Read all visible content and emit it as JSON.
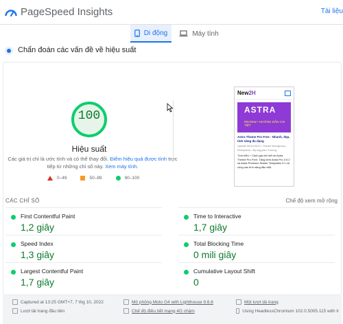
{
  "header": {
    "title": "PageSpeed Insights",
    "right_link": "Tài liệu"
  },
  "tabs": [
    {
      "label": "Di động",
      "active": true,
      "icon": "smartphone-icon"
    },
    {
      "label": "Máy tính",
      "active": false,
      "icon": "laptop-icon"
    }
  ],
  "diagnose": {
    "text": "Chẩn đoán các vấn đề về hiệu suất"
  },
  "performance": {
    "score": "100",
    "label": "Hiệu suất",
    "note_pre": "Các giá trị chỉ là ước tính và có thể thay đổi.",
    "note_link1": "Điểm hiệu quả được tính",
    "note_mid": "trực tiếp từ những chỉ số này.",
    "note_link2": "Xem máy tính",
    "note_end": ".",
    "legend": [
      {
        "range": "0–49",
        "shape": "triangle",
        "color": "#d93025"
      },
      {
        "range": "50–89",
        "shape": "square",
        "color": "#fa9a25"
      },
      {
        "range": "90–100",
        "shape": "circle",
        "color": "#0cce6b"
      }
    ],
    "colors": {
      "good": "#0cce6b",
      "good_text": "#0c7a2c"
    }
  },
  "preview": {
    "logo_main": "New",
    "logo_accent": "2H",
    "banner_title": "ASTRA",
    "banner_sub": "REVIEW • HƯỚNG DẪN CHI TIẾT",
    "article_title": "Astra Theme Pro Free - Nhanh, đẹp, tính năng đa dạng",
    "article_meta": "Update 06/11/2022 / Theme Wordpress, Wordpress / By tag plan 4 luong",
    "article_body": "Tình hiểu + Cách gia chỉ hiết về Astra Theme Pro Free, Tặng kèm Astra Pro 3.9.2 và Astra Premium Starter Templates 3.1.16 cùng các tính năng đặc biệt."
  },
  "metrics_section": {
    "title": "CÁC CHỈ SỐ",
    "expand_link": "Chế độ xem mở rộng"
  },
  "metrics": [
    {
      "label": "First Contentful Paint",
      "value": "1,2 giây"
    },
    {
      "label": "Time to Interactive",
      "value": "1,7 giây"
    },
    {
      "label": "Speed Index",
      "value": "1,3 giây"
    },
    {
      "label": "Total Blocking Time",
      "value": "0 mili giây"
    },
    {
      "label": "Largest Contentful Paint",
      "value": "1,7 giây"
    },
    {
      "label": "Cumulative Layout Shift",
      "value": "0"
    }
  ],
  "footer": {
    "captured": "Captured at 13:25 GMT+7, 7 thg 10, 2022",
    "device": "Mô phỏng Moto G4 with Lighthouse 9.6.6",
    "session": "Một lượt tải trang",
    "initial_load": "Lượt tải trang đầu tiên",
    "throttling": "Chế độ điều tiết mạng 4G chậm",
    "browser": "Using HeadlessChromium 102.0.5005.115 with lr"
  }
}
